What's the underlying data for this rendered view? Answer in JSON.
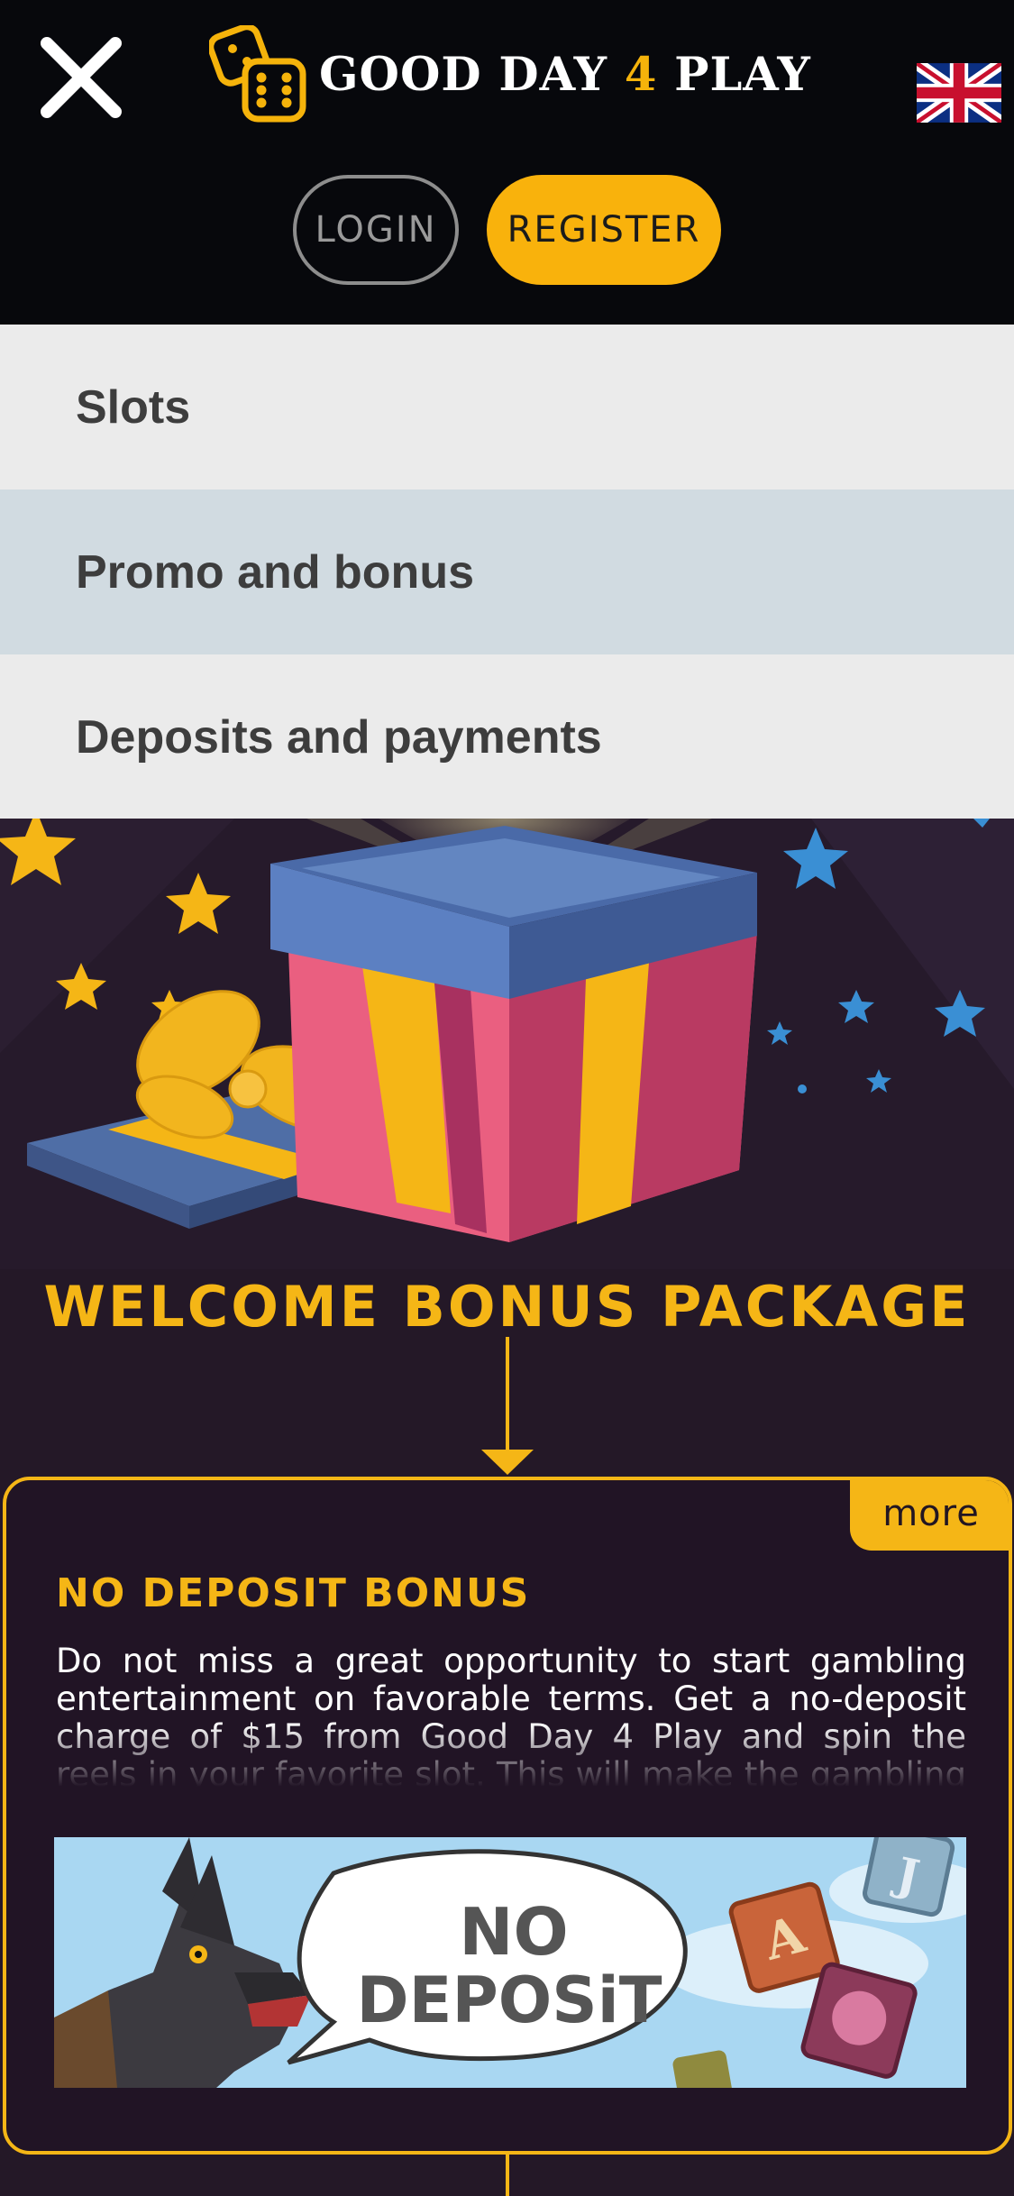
{
  "header": {
    "logo_text_1": "GOOD DAY",
    "logo_text_accent": "4",
    "logo_text_2": "PLAY",
    "login_label": "LOGIN",
    "register_label": "REGISTER",
    "language_flag": "uk-flag-icon"
  },
  "menu": {
    "items": [
      {
        "label": "Slots"
      },
      {
        "label": "Promo and bonus"
      },
      {
        "label": "Deposits and payments"
      }
    ]
  },
  "hero": {
    "title": "WELCOME BONUS PACKAGE"
  },
  "card": {
    "more_label": "more",
    "title": "NO DEPOSIT BONUS",
    "text": "Do not miss a great opportunity to start gambling entertainment on favorable terms. Get a no-deposit charge of $15 from Good Day 4 Play and spin the reels in your favorite slot. This will make the gambling experience really comfortable.",
    "banner_text_1": "NO",
    "banner_text_2": "DEPOSiT"
  },
  "colors": {
    "accent": "#f5b616",
    "header_bg": "#07080c",
    "page_bg": "#241827",
    "menu_active": "#d1dbe1",
    "menu_bg": "#ebebeb"
  }
}
